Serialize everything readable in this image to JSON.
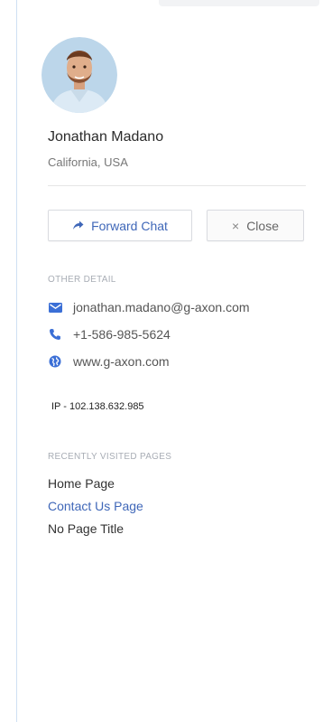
{
  "profile": {
    "name": "Jonathan Madano",
    "location": "California, USA"
  },
  "actions": {
    "forward_label": "Forward Chat",
    "close_label": "Close",
    "close_symbol": "×"
  },
  "other_detail": {
    "title": "OTHER DETAIL",
    "email": "jonathan.madano@g-axon.com",
    "phone": "+1-586-985-5624",
    "website": "www.g-axon.com",
    "ip": "IP - 102.138.632.985"
  },
  "recent_pages": {
    "title": "RECENTLY VISITED PAGES",
    "items": [
      "Home Page",
      "Contact Us Page",
      "No Page Title"
    ]
  },
  "colors": {
    "accent": "#3f67b8",
    "icon_blue": "#3b6fd6",
    "muted": "#a8adb5"
  }
}
